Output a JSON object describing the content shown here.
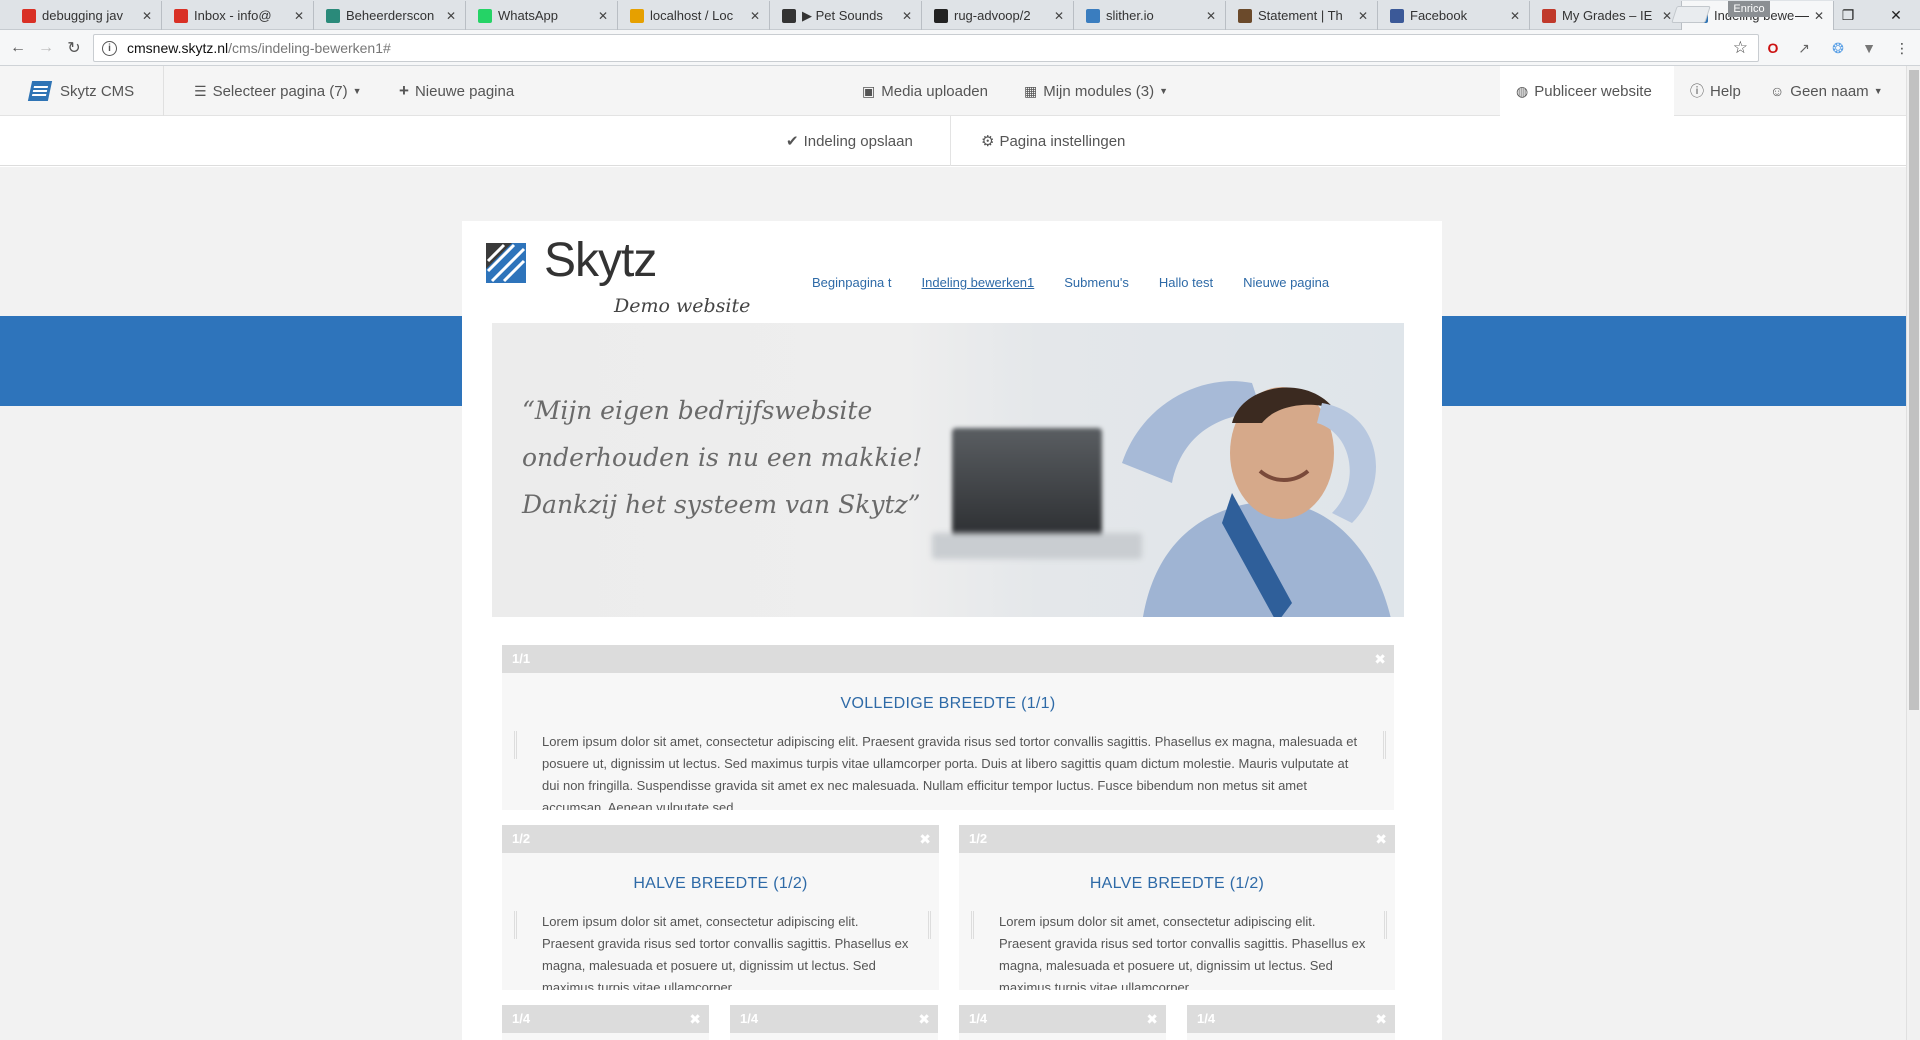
{
  "browser": {
    "tabs": [
      {
        "title": "debugging jav",
        "icon": "gmail-icon",
        "color": "#d93025"
      },
      {
        "title": "Inbox - info@",
        "icon": "gmail-icon",
        "color": "#d93025"
      },
      {
        "title": "Beheerderscon",
        "icon": "admin-icon",
        "color": "#2a8a7a"
      },
      {
        "title": "WhatsApp",
        "icon": "whatsapp-icon",
        "color": "#25d366"
      },
      {
        "title": "localhost / Loc",
        "icon": "phpmyadmin-icon",
        "color": "#e6a000"
      },
      {
        "title": "▶ Pet Sounds",
        "icon": "playing-dot-icon",
        "color": "#333333"
      },
      {
        "title": "rug-advoop/2",
        "icon": "github-icon",
        "color": "#222222"
      },
      {
        "title": "slither.io",
        "icon": "slither-icon",
        "color": "#3a7dbf"
      },
      {
        "title": "Statement | Th",
        "icon": "statement-icon",
        "color": "#6b4a2b"
      },
      {
        "title": "Facebook",
        "icon": "facebook-icon",
        "color": "#3b5998"
      },
      {
        "title": "My Grades – IE",
        "icon": "grades-icon",
        "color": "#c0392b"
      },
      {
        "title": "Indeling bewe",
        "icon": "skytz-icon",
        "color": "#2f74b5"
      }
    ],
    "profile": "Enrico",
    "url_host": "cmsnew.skytz.nl",
    "url_path": "/cms/indeling-bewerken1#"
  },
  "cms": {
    "brand": "Skytz CMS",
    "select_page": "Selecteer pagina (7)",
    "new_page": "Nieuwe pagina",
    "media_upload": "Media uploaden",
    "my_modules": "Mijn modules (3)",
    "publish": "Publiceer website",
    "help": "Help",
    "user": "Geen naam",
    "save_layout": "Indeling opslaan",
    "page_settings": "Pagina instellingen"
  },
  "site": {
    "logo_text": "Skytz",
    "logo_tagline": "Demo website",
    "nav": [
      "Beginpagina t",
      "Indeling bewerken1",
      "Submenu's",
      "Hallo test",
      "Nieuwe pagina"
    ],
    "active_nav": 1,
    "quote": "“Mijn eigen bedrijfswebsite\nonderhouden is nu een makkie!\nDankzij het systeem van Skytz”",
    "accent": "#2e74bb"
  },
  "blocks": {
    "full": {
      "label": "1/1",
      "title": "VOLLEDIGE BREEDTE (1/1)",
      "text": "Lorem ipsum dolor sit amet, consectetur adipiscing elit. Praesent gravida risus sed tortor convallis sagittis. Phasellus ex magna, malesuada et posuere ut, dignissim ut lectus. Sed maximus turpis vitae ullamcorper porta. Duis at libero sagittis quam dictum molestie. Mauris vulputate at dui non fringilla. Suspendisse gravida sit amet ex nec malesuada. Nullam efficitur tempor luctus. Fusce bibendum non metus sit amet accumsan. Aenean vulputate sed"
    },
    "half_left": {
      "label": "1/2",
      "title": "HALVE BREEDTE (1/2)",
      "text": "Lorem ipsum dolor sit amet, consectetur adipiscing elit. Praesent gravida risus sed tortor convallis sagittis. Phasellus ex magna, malesuada et posuere ut, dignissim ut lectus. Sed maximus turpis vitae ullamcorper"
    },
    "half_right": {
      "label": "1/2",
      "title": "HALVE BREEDTE (1/2)",
      "text": "Lorem ipsum dolor sit amet, consectetur adipiscing elit. Praesent gravida risus sed tortor convallis sagittis. Phasellus ex magna, malesuada et posuere ut, dignissim ut lectus. Sed maximus turpis vitae ullamcorper"
    },
    "quarters": [
      "1/4",
      "1/4",
      "1/4",
      "1/4"
    ]
  }
}
